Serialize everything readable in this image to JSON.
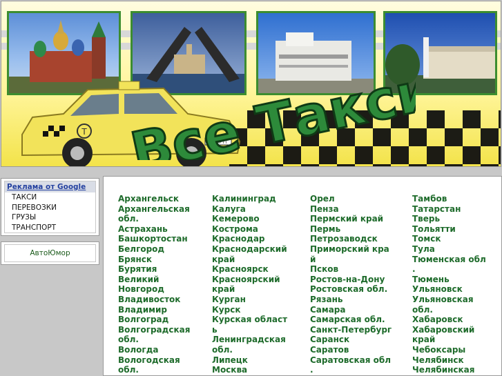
{
  "header": {
    "logo_text": "Все Такси",
    "car_label": "T",
    "plate_text": "Т 000 ТТ"
  },
  "sidebar": {
    "ads_title": "Реклама от Google",
    "ads_links": [
      "ТАКСИ",
      "ПЕРЕВОЗКИ",
      "ГРУЗЫ",
      "ТРАНСПОРТ"
    ],
    "humor_link": "АвтоЮмор"
  },
  "cities": {
    "col1": [
      "Архангельск",
      "Архангельская",
      "обл.",
      "Астрахань",
      "Башкортостан",
      "Белгород",
      "Брянск",
      "Бурятия",
      "Великий",
      "Новгород",
      "Владивосток",
      "Владимир",
      "Волгоград",
      "Волгоградская",
      "обл.",
      "Вологда",
      "Вологодская",
      "обл."
    ],
    "col2": [
      "Калининград",
      "Калуга",
      "Кемерово",
      "Кострома",
      "Краснодар",
      "Краснодарский",
      "край",
      "Красноярск",
      "Красноярский",
      "край",
      "Курган",
      "Курск",
      "Курская област",
      "ь",
      "Ленинградская",
      "обл.",
      "Липецк",
      "Москва"
    ],
    "col3": [
      "Орел",
      "Пенза",
      "Пермский край",
      "Пермь",
      "Петрозаводск",
      "Приморский кра",
      "й",
      "Псков",
      "Ростов-на-Дону",
      "Ростовская обл.",
      "Рязань",
      "Самара",
      "Самарская обл.",
      "Санкт-Петербург",
      "Саранск",
      "Саратов",
      "Саратовская обл",
      "."
    ],
    "col4": [
      "Тамбов",
      "Татарстан",
      "Тверь",
      "Тольятти",
      "Томск",
      "Тула",
      "Тюменская обл",
      ".",
      "Тюмень",
      "Ульяновск",
      "Ульяновская",
      "обл.",
      "Хабаровск",
      "Хабаровский",
      "край",
      "Чебоксары",
      "Челябинск",
      "Челябинская"
    ]
  },
  "colors": {
    "link_green": "#1e6b2b",
    "banner_yellow": "#f3e34a",
    "frame_green": "#3c8d2f"
  }
}
